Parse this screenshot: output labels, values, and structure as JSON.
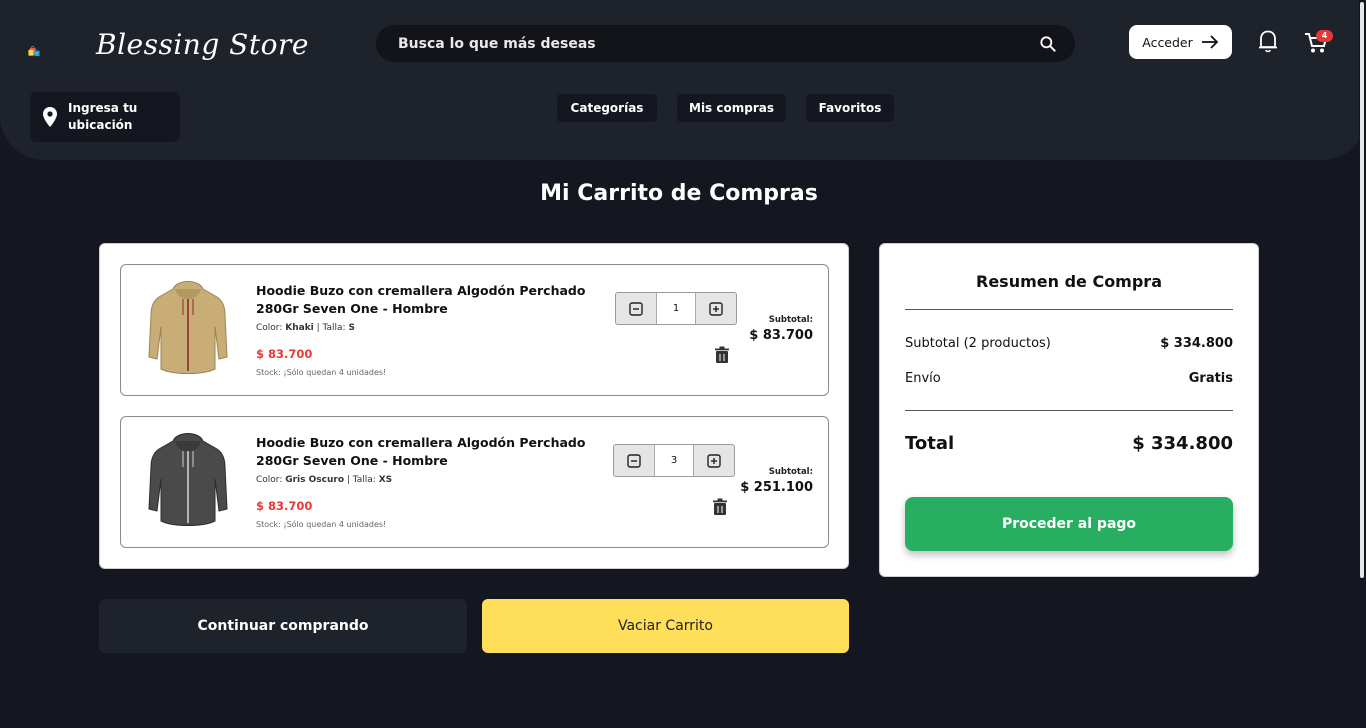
{
  "brand": {
    "name": "Blessing Store"
  },
  "search": {
    "placeholder": "Busca lo que más deseas"
  },
  "header": {
    "login_label": "Acceder",
    "cart_count": "4",
    "location_label": "Ingresa tu ubicación",
    "nav": [
      "Categorías",
      "Mis compras",
      "Favoritos"
    ]
  },
  "page": {
    "title": "Mi Carrito de Compras"
  },
  "cart": {
    "items": [
      {
        "name": "Hoodie Buzo con cremallera Algodón Perchado 280Gr Seven One - Hombre",
        "color_label": "Color: ",
        "color": "Khaki",
        "size_label": " | Talla: ",
        "size": "S",
        "price": "$ 83.700",
        "stock": "Stock: ¡Sólo quedan 4 unidades!",
        "quantity": "1",
        "subtotal_label": "Subtotal:",
        "subtotal": "$ 83.700",
        "image_color": "#c9ad77"
      },
      {
        "name": "Hoodie Buzo con cremallera Algodón Perchado 280Gr Seven One - Hombre",
        "color_label": "Color: ",
        "color": "Gris Oscuro",
        "size_label": " | Talla: ",
        "size": "XS",
        "price": "$ 83.700",
        "stock": "Stock: ¡Sólo quedan 4 unidades!",
        "quantity": "3",
        "subtotal_label": "Subtotal:",
        "subtotal": "$ 251.100",
        "image_color": "#4a4a4a"
      }
    ]
  },
  "summary": {
    "title": "Resumen de Compra",
    "subtotal_label": "Subtotal (2 productos)",
    "subtotal_value": "$ 334.800",
    "shipping_label": "Envío",
    "shipping_value": "Gratis",
    "total_label": "Total",
    "total_value": "$ 334.800",
    "pay_label": "Proceder al pago"
  },
  "actions": {
    "continue_label": "Continuar comprando",
    "empty_label": "Vaciar Carrito"
  },
  "colors": {
    "background": "#14171f",
    "header": "#1e222b",
    "price_red": "#e53935",
    "pay_green": "#27ae60",
    "empty_yellow": "#ffde59"
  }
}
